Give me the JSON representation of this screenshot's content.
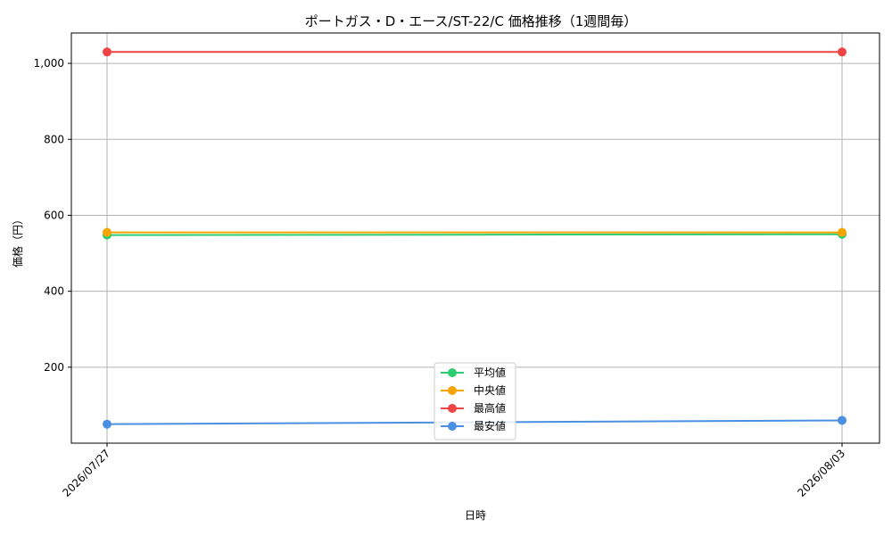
{
  "chart_data": {
    "type": "line",
    "title": "ポートガス・D・エース/ST-22/C 価格推移（1週間毎）",
    "xlabel": "日時",
    "ylabel": "価格（円）",
    "x": [
      "2026/07/27",
      "2026/08/03"
    ],
    "ylim": [
      0,
      1080
    ],
    "yticks": [
      200,
      400,
      600,
      800,
      1000
    ],
    "ytick_labels": [
      "200",
      "400",
      "600",
      "800",
      "1,000"
    ],
    "grid": true,
    "legend_position": "bottom-center",
    "series": [
      {
        "name": "平均値",
        "values": [
          548,
          550
        ],
        "color": "#2ecc71"
      },
      {
        "name": "中央値",
        "values": [
          555,
          555
        ],
        "color": "#f5a400"
      },
      {
        "name": "最高値",
        "values": [
          1030,
          1030
        ],
        "color": "#ef4444"
      },
      {
        "name": "最安値",
        "values": [
          50,
          60
        ],
        "color": "#4a90e2"
      }
    ]
  }
}
